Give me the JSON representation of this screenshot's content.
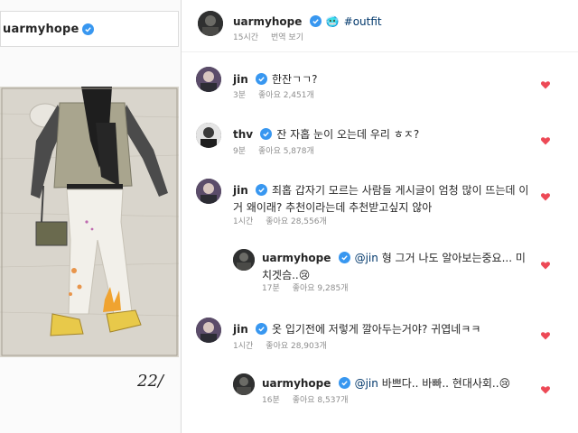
{
  "left_panel": {
    "username": "uarmyhope",
    "photo_note": "22/"
  },
  "post": {
    "username": "uarmyhope",
    "emoji": "🥶",
    "hashtag": "#outfit",
    "time": "15시간",
    "translate": "번역 보기"
  },
  "comments": [
    {
      "username": "jin",
      "text": "한잔ㄱㄱ?",
      "mention": "",
      "time": "3분",
      "likes": "좋아요 2,451개",
      "reply": false
    },
    {
      "username": "thv",
      "text": "잔 자홉 눈이 오는데 우리 ㅎㅈ?",
      "mention": "",
      "time": "9분",
      "likes": "좋아요 5,878개",
      "reply": false
    },
    {
      "username": "jin",
      "text": "죄홉 갑자기 모르는 사람들 게시글이 엄청 많이 뜨는데 이거 왜이래? 추천이라는데 추천받고싶지 않아",
      "mention": "",
      "time": "1시간",
      "likes": "좋아요 28,556개",
      "reply": false
    },
    {
      "username": "uarmyhope",
      "mention": "@jin",
      "text": " 형 그거 나도 알아보는중요... 미치겟슴..😢",
      "time": "17분",
      "likes": "좋아요 9,285개",
      "reply": true
    },
    {
      "username": "jin",
      "text": "옷 입기전에 저렇게 깔아두는거야? 귀엽네ㅋㅋ",
      "mention": "",
      "time": "1시간",
      "likes": "좋아요 28,903개",
      "reply": false
    },
    {
      "username": "uarmyhope",
      "mention": "@jin",
      "text": " 바쁘다.. 바빠.. 현대사회..😢",
      "time": "16분",
      "likes": "좋아요 8,537개",
      "reply": true
    }
  ],
  "colors": {
    "verified": "#3897f0",
    "heart": "#ed4956",
    "meta": "#8e8e8e",
    "link": "#00376b"
  },
  "icons": [
    "verified-badge-icon",
    "heart-icon"
  ]
}
